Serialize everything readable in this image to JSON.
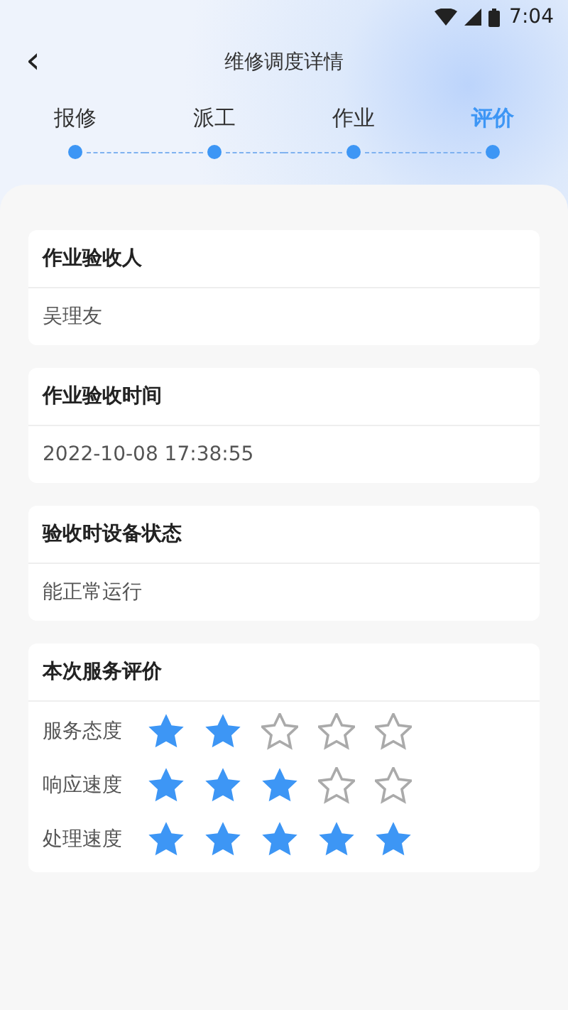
{
  "status_bar": {
    "time": "7:04"
  },
  "header": {
    "back": "‹",
    "title": "维修调度详情"
  },
  "steps": [
    {
      "label": "报修",
      "selected": false
    },
    {
      "label": "派工",
      "selected": false
    },
    {
      "label": "作业",
      "selected": false
    },
    {
      "label": "评价",
      "selected": true
    }
  ],
  "cards": [
    {
      "title": "作业验收人",
      "value": "吴理友"
    },
    {
      "title": "作业验收时间",
      "value": "2022-10-08 17:38:55"
    },
    {
      "title": "验收时设备状态",
      "value": "能正常运行"
    }
  ],
  "rating": {
    "title": "本次服务评价",
    "rows": [
      {
        "label": "服务态度",
        "stars": 2
      },
      {
        "label": "响应速度",
        "stars": 3
      },
      {
        "label": "处理速度",
        "stars": 5
      }
    ]
  }
}
